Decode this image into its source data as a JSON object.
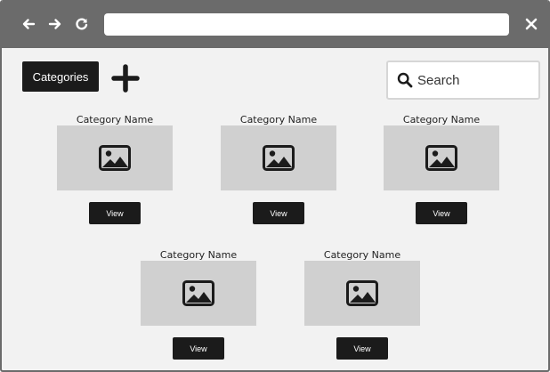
{
  "browser": {
    "back_icon": "arrow-left-icon",
    "forward_icon": "arrow-right-icon",
    "reload_icon": "reload-icon",
    "close_icon": "close-icon",
    "address_value": ""
  },
  "toolbar": {
    "categories_label": "Categories",
    "add_icon": "plus-icon"
  },
  "search": {
    "placeholder": "Search",
    "icon": "search-icon"
  },
  "cards": [
    {
      "name": "Category Name",
      "view_label": "View",
      "image_icon": "image-icon"
    },
    {
      "name": "Category Name",
      "view_label": "View",
      "image_icon": "image-icon"
    },
    {
      "name": "Category Name",
      "view_label": "View",
      "image_icon": "image-icon"
    },
    {
      "name": "Category Name",
      "view_label": "View",
      "image_icon": "image-icon"
    },
    {
      "name": "Category Name",
      "view_label": "View",
      "image_icon": "image-icon"
    }
  ],
  "colors": {
    "chrome": "#6b6b6b",
    "page_background": "#f2f2f2",
    "button_dark": "#1b1b1b",
    "placeholder_image": "#d0d0d0"
  }
}
